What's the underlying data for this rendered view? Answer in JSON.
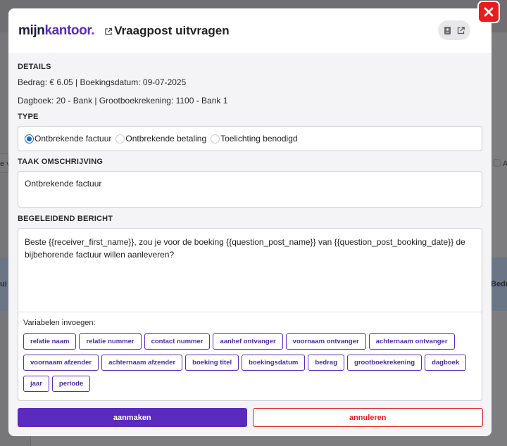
{
  "background": {
    "fragment_left": "e v",
    "fragment_left2": "ui",
    "fragment_right": "Bedr",
    "fragment_right2": "A"
  },
  "header": {
    "logo_part1": "mijn",
    "logo_part2": "kantoor",
    "logo_dot": ".",
    "title": "Vraagpost uitvragen"
  },
  "details": {
    "label": "DETAILS",
    "line1": "Bedrag: € 6.05 | Boekingsdatum: 09-07-2025",
    "line2": "Dagboek: 20 - Bank | Grootboekrekening: 1100 - Bank 1"
  },
  "type": {
    "label": "TYPE",
    "options": [
      {
        "label": "Ontbrekende factuur",
        "checked": true
      },
      {
        "label": "Ontbrekende betaling",
        "checked": false
      },
      {
        "label": "Toelichting benodigd",
        "checked": false
      }
    ]
  },
  "task": {
    "label": "TAAK OMSCHRIJVING",
    "value": "Ontbrekende factuur"
  },
  "message": {
    "label": "BEGELEIDEND BERICHT",
    "value": "Beste {{receiver_first_name}}, zou je voor de boeking {{question_post_name}} van {{question_post_booking_date}} de bijbehorende factuur willen aanleveren?",
    "variables_label": "Variabelen invoegen:",
    "variables": [
      "relatie naam",
      "relatie nummer",
      "contact nummer",
      "aanhef ontvanger",
      "voornaam ontvanger",
      "achternaam ontvanger",
      "voornaam afzender",
      "achternaam afzender",
      "boeking titel",
      "boekingsdatum",
      "bedrag",
      "grootboekrekening",
      "dagboek",
      "jaar",
      "periode"
    ]
  },
  "actions": {
    "create_label": "aanmaken",
    "cancel_label": "annuleren"
  },
  "colors": {
    "brand": "#5b2bc0",
    "danger": "#e02020",
    "radio": "#1a63d6"
  }
}
